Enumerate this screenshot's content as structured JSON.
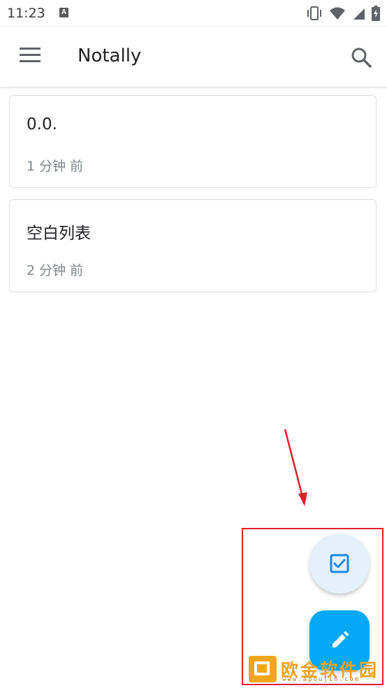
{
  "status_bar": {
    "time": "11:23",
    "notification_icon": "A",
    "icons": [
      "vibrate-icon",
      "wifi-icon",
      "signal-icon",
      "battery-charging-icon"
    ]
  },
  "app_bar": {
    "title": "Notally",
    "menu_icon": "menu-icon",
    "search_icon": "search-icon"
  },
  "notes": [
    {
      "title": "0.0.",
      "time": "1 分钟 前"
    },
    {
      "title": "空白列表",
      "time": "2 分钟 前"
    }
  ],
  "fabs": {
    "checklist_icon": "checklist-icon",
    "new_note_icon": "pencil-icon"
  },
  "watermark": {
    "text": "欧金软件园",
    "url": "www.apoujin.com"
  },
  "colors": {
    "accent": "#03a9f4",
    "fab_secondary": "#e4f1fb",
    "annotation_red": "#e0212b"
  }
}
